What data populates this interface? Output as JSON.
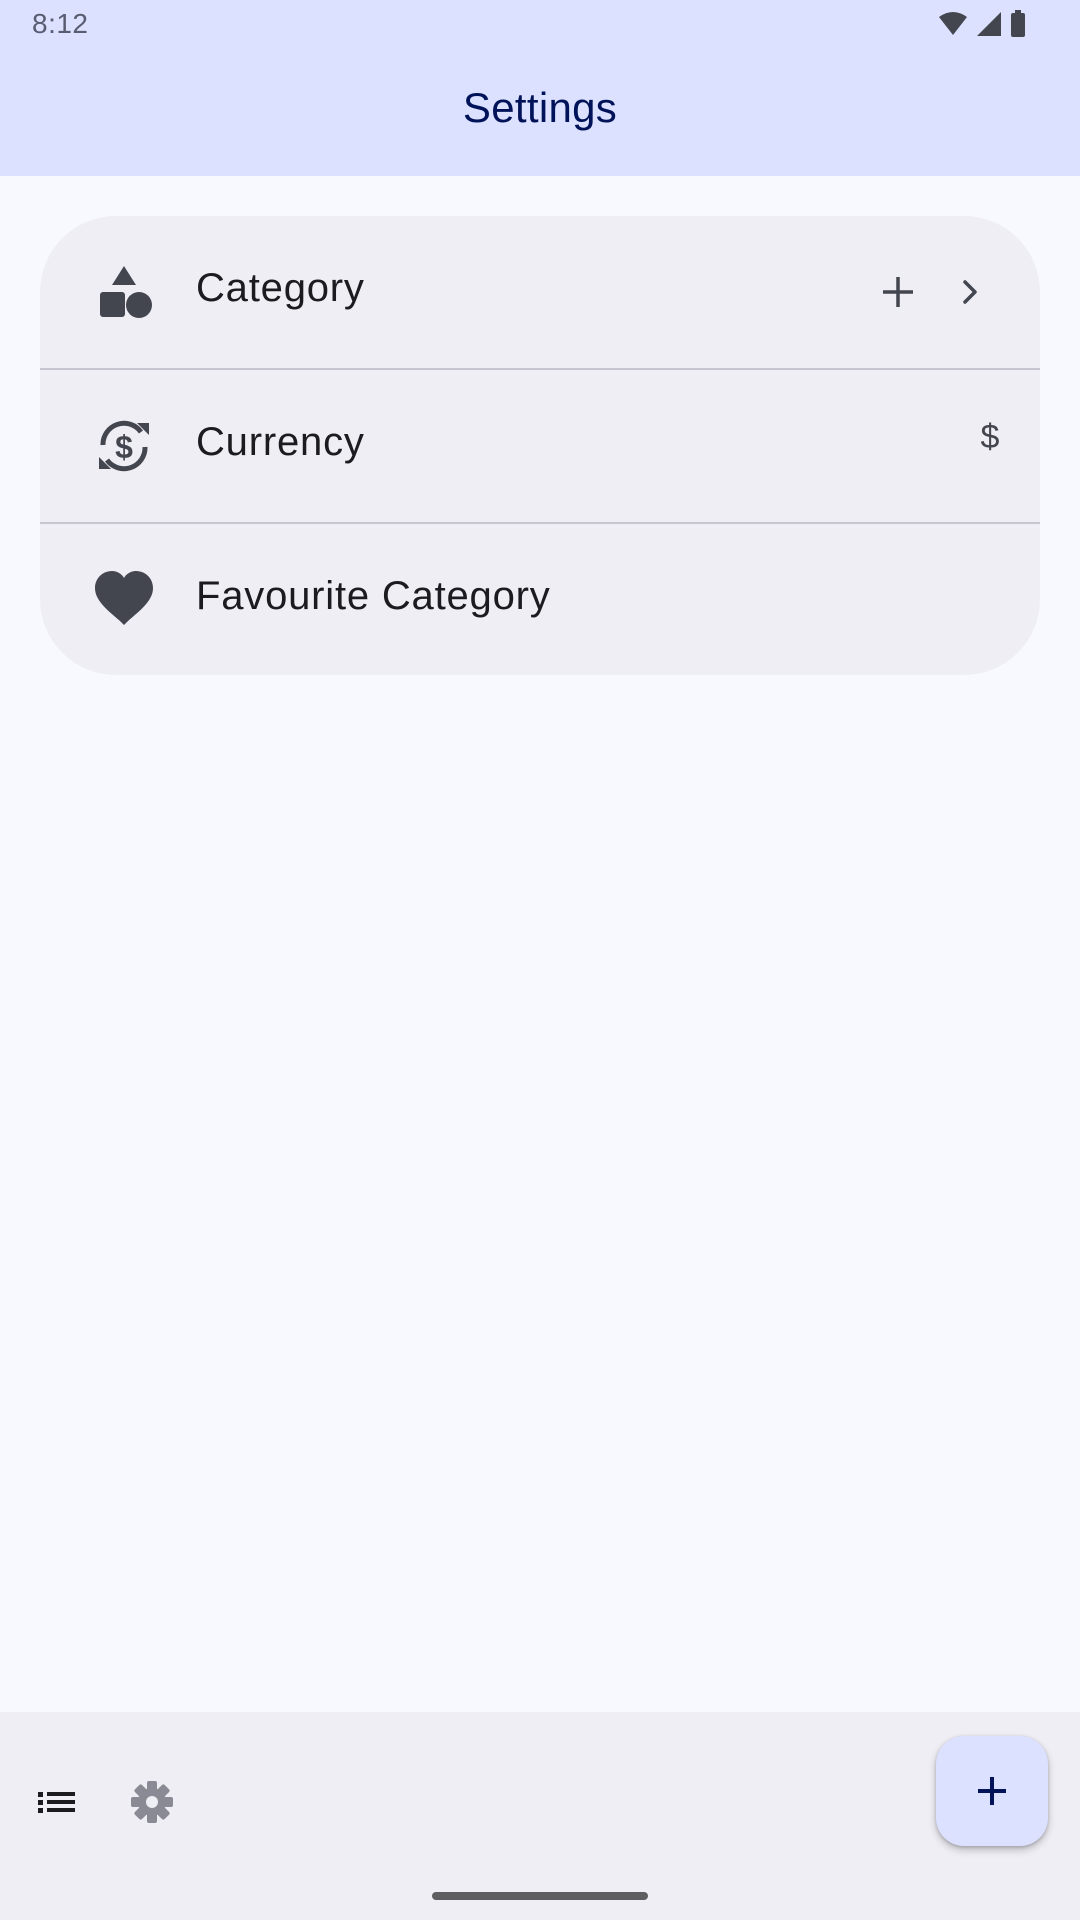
{
  "status_bar": {
    "time": "8:12",
    "icons": [
      "wifi-icon",
      "cellular-signal-icon",
      "battery-icon"
    ]
  },
  "app_bar": {
    "title": "Settings"
  },
  "settings": {
    "items": [
      {
        "label": "Category",
        "icon": "category-shapes-icon",
        "actions": [
          "add-icon",
          "chevron-right-icon"
        ]
      },
      {
        "label": "Currency",
        "icon": "currency-exchange-icon",
        "value": "$"
      },
      {
        "label": "Favourite Category",
        "icon": "heart-icon"
      }
    ]
  },
  "bottom_bar": {
    "nav_items": [
      "list-icon",
      "settings-gear-icon"
    ],
    "fab_icon": "add-icon"
  },
  "colors": {
    "app_bar_background": "#DBE1FF",
    "title_color": "#001258",
    "page_background": "#F8F8FF",
    "card_background": "#EEEEF4",
    "icon_color": "#44464F",
    "fab_background": "#DBE1FF",
    "fab_icon_color": "#001258"
  }
}
